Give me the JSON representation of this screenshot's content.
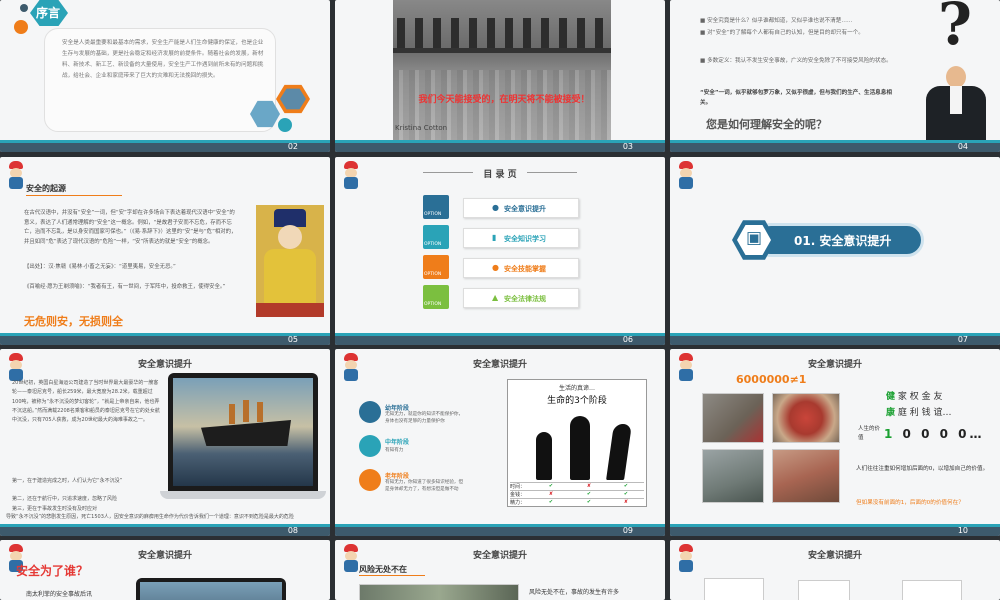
{
  "slides": {
    "s02": {
      "num": "02",
      "title": "序言",
      "body": "安全是人类最重要和最基本的需求，安全生产能是人们生命健康的保证，也是企业生存与发展的基础，更是社会稳定和经济发展的前提条件。随着社会的发展，新材料、新技术、新工艺、新设备的大量使用，安全生产工作遇到前所未有的问题和挑战，给社会、企业和家庭带来了巨大的灾难和无法挽回的损失。"
    },
    "s03": {
      "num": "03",
      "caption": "我们今天能接受的，在明天将不能被接受！",
      "author": "Kristina Cotton"
    },
    "s04": {
      "num": "04",
      "q1": "安全究竟是什么？似乎谁都知道，又似乎谁也说不清楚……",
      "q2": "对“安全”的了解每个人都有自己的认知，但是目的却只有一个。",
      "q3": "多数定义：我认不发生安全事故，广义的安全免除了不可接受风险的状态。",
      "q4": "“安全”一词，似乎就够包罗万象，又似乎很虚，但与我们的生产、生活息息相关。",
      "question": "您是如何理解安全的呢？"
    },
    "s05": {
      "num": "05",
      "heading": "安全的起源",
      "para1": "在古代汉语中，并没有“安全”一词，但“安”字却在许多场合下表达着现代汉语中“安全”的意义，表达了人们通常理解的“安全”这一概念。例如，“是故君子安而不忘危，存而不忘亡，治而不忘乱，是以身安而国家可保也。”（《易·系辞下》）这里的“安”是与“危”相对的，并且如同“危”表达了现代汉语的“危险”一样，“安”所表达的就是“安全”的概念。",
      "para2": "【出处】：汉·焦赣《易林·小畜之无妄》：“道里夷易，安全无忌。”",
      "para3": "《百喻经·愿为王剃须喻》：“我者有王，有一世间，于军阵中，投命救王，使得安全。”",
      "motto": "无危则安，无损则全"
    },
    "s06": {
      "num": "06",
      "title": "目 录 页",
      "option": "OPTION",
      "items": [
        "安全意识提升",
        "安全知识学习",
        "安全技能掌握",
        "安全法律法规"
      ]
    },
    "s07": {
      "num": "07",
      "section": "01. 安全意识提升"
    },
    "s08": {
      "num": "08",
      "title": "安全意识提升",
      "text1": "20世纪初，英国白星海运公司建造了当时世界最大最豪华的一艘客轮——泰坦尼克号，船长259米，最大宽度为28.2米，载重超过100吨，被称为“永不沉没的梦幻客轮”，“就是上帝亲自来，他也弄不沉这船。”然而满载2208名乘客和船员的泰坦尼克号在它的处女航中沉没，只有705人获救，成为20世纪最大的海难事故之一。",
      "text2": "在事后的调查和反思中，人们认为，导致事故的原因除了人们常说的冰山与航行速度之外，最关键的问题在于思想意识上的麻痹大意。",
      "list1": "第一，在于建造完成之时，人们认为它“永不沉没”",
      "list2": "第二，还在于航行中，只追求速度，忽略了风险",
      "list3": "第三，更在于事故发生时没有及时应对",
      "bottom": "导致“永不沉没”的悲剧发生原因，死亡1503人，因安全意识的麻痹用生命作为代价告诉我们一个道理：意识不到危险是最大的危险"
    },
    "s09": {
      "num": "09",
      "title": "安全意识提升",
      "stage1_title": "幼年阶段",
      "stage1_text": "无知无力，就是你的知识不能保护你，身体也没有足够的力量保护你",
      "stage2_title": "中年阶段",
      "stage2_text": "有知有力",
      "stage3_title": "老年阶段",
      "stage3_text": "有知无力，你知道了很多知识经验，但是身体却无力了，有想法但是做不动",
      "truth_small": "生活的真谛…",
      "truth_big": "生命的3个阶段",
      "table_rows": [
        "时间：",
        "金钱：",
        "精力："
      ]
    },
    "s10": {
      "num": "10",
      "title": "安全意识提升",
      "formula": "6000000≠1",
      "row1_first": "健",
      "row1_rest": "家 权 金 友",
      "row2_first": "康",
      "row2_rest": "庭 利 钱 谊…",
      "value_label": "人生的价值",
      "value_first": "1",
      "value_rest": "0 0 0 0…",
      "note1": "人们往往注重如何增加后面的0，以增加自己的价值。",
      "note2": "但如果没有前面的1，后面的0的价值何在？"
    },
    "s11": {
      "title": "安全意识提升",
      "heading": "安全为了谁？",
      "sub": "南太利菲的安全事故后讯"
    },
    "s12": {
      "title": "安全意识提升",
      "heading": "风险无处不在",
      "text": "风险无处不在，事故的发生有许多"
    },
    "s13": {
      "title": "安全意识提升"
    }
  },
  "colors": {
    "teal": "#2aa3b7",
    "navy": "#3d5a6c",
    "orange": "#ef7d1a",
    "red": "#e53935",
    "green": "#1aa031"
  }
}
